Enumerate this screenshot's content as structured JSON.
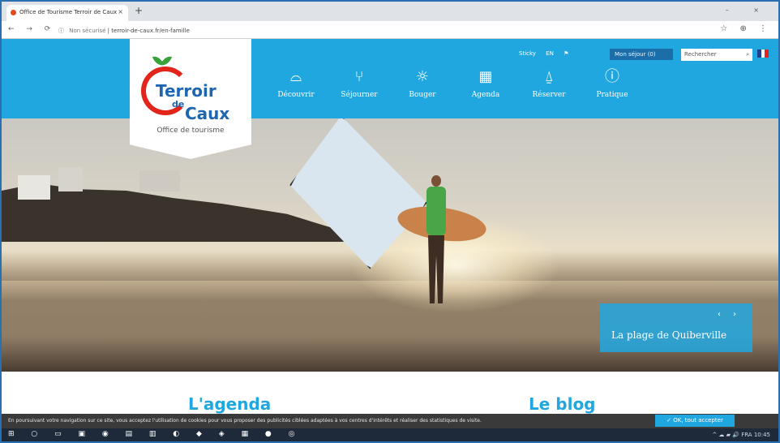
{
  "browser": {
    "tab_title": "Office de Tourisme Terroir de Caux",
    "tab_close": "×",
    "new_tab": "+",
    "url_security": "Non sécurisé",
    "url": "terroir-de-caux.fr/en-famille",
    "nav_buttons": "← → ⟳",
    "window_controls": "– ×",
    "toolbar_icons": "☆ ⊕ ⋮"
  },
  "logo": {
    "line1": "Terroir",
    "line2": "de",
    "line3": "Caux",
    "subtitle": "Office de tourisme"
  },
  "utilities": {
    "items": [
      "Sticky",
      "EN"
    ],
    "badge": "Mon séjour (0)",
    "search_placeholder": "Rechercher"
  },
  "nav": {
    "items": [
      {
        "label": "Découvrir",
        "icon": "cloche"
      },
      {
        "label": "Séjourner",
        "icon": "fork"
      },
      {
        "label": "Bouger",
        "icon": "sun"
      },
      {
        "label": "Agenda",
        "icon": "calendar"
      },
      {
        "label": "Réserver",
        "icon": "bell"
      },
      {
        "label": "Pratique",
        "icon": "info"
      }
    ]
  },
  "hero": {
    "caption": "La plage de Quiberville",
    "arrows": "‹ ›"
  },
  "sections": {
    "agenda": "L'agenda",
    "blog": "Le blog"
  },
  "cookie": {
    "text": "En poursuivant votre navigation sur ce site, vous acceptez l'utilisation de cookies pour vous proposer des publicités ciblées adaptées à vos centres d'intérêts et réaliser des statistiques de visite.",
    "ok_label": "✓ OK, tout accepter"
  },
  "taskbar": {
    "icons": "⊞ ○ ▭ ▣ ◉ ▤ ▥ ◐ ◆ ◈ ▦ ● ◎",
    "tray": "^ ☁ ▰ 🔊 FRA 10:45"
  },
  "colors": {
    "brand_blue": "#21a7e0",
    "logo_red": "#e3241b",
    "logo_blue": "#1f66b1"
  }
}
